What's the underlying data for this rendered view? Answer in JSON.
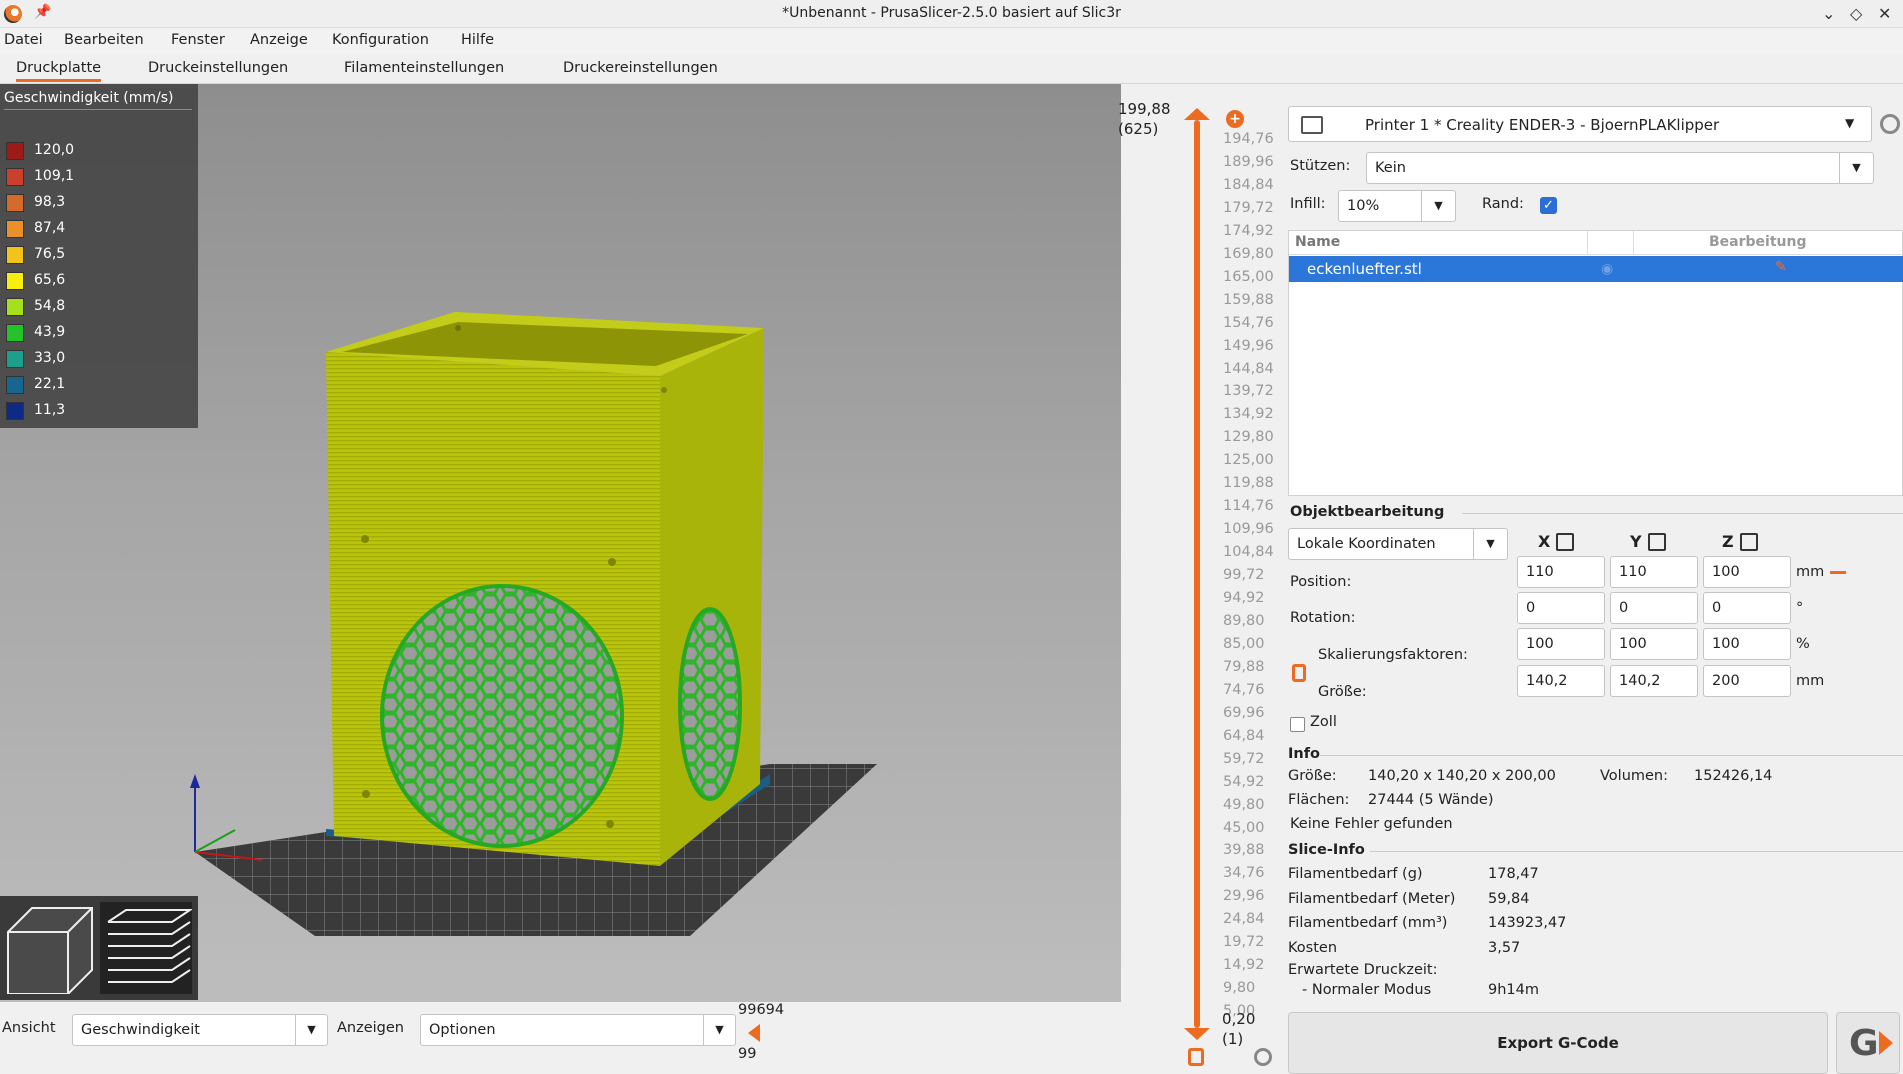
{
  "window": {
    "title": "*Unbenannt - PrusaSlicer-2.5.0 basiert auf Slic3r"
  },
  "menu": [
    "Datei",
    "Bearbeiten",
    "Fenster",
    "Anzeige",
    "Konfiguration",
    "Hilfe"
  ],
  "tabs": [
    "Druckplatte",
    "Druckeinstellungen",
    "Filamenteinstellungen",
    "Druckereinstellungen"
  ],
  "legend": {
    "title": "Geschwindigkeit (mm/s)",
    "items": [
      {
        "value": "120,0",
        "color": "#9c1a1a"
      },
      {
        "value": "109,1",
        "color": "#c9402c"
      },
      {
        "value": "98,3",
        "color": "#d46a2c"
      },
      {
        "value": "87,4",
        "color": "#e8902a"
      },
      {
        "value": "76,5",
        "color": "#f2c21d"
      },
      {
        "value": "65,6",
        "color": "#f7ee0d"
      },
      {
        "value": "54,8",
        "color": "#a5e01b"
      },
      {
        "value": "43,9",
        "color": "#26c22b"
      },
      {
        "value": "33,0",
        "color": "#1e9e8c"
      },
      {
        "value": "22,1",
        "color": "#16668f"
      },
      {
        "value": "11,3",
        "color": "#0c2a86"
      }
    ]
  },
  "bottom": {
    "ansicht_label": "Ansicht",
    "ansicht_value": "Geschwindigkeit",
    "anzeigen_label": "Anzeigen",
    "anzeigen_value": "Optionen",
    "hslider_top": "99694",
    "hslider_bottom": "99"
  },
  "vslider": {
    "top_value": "199,88",
    "top_layer": "(625)",
    "bottom_value": "0,20",
    "bottom_layer": "(1)",
    "ticks": [
      "194,76",
      "189,96",
      "184,84",
      "179,72",
      "174,92",
      "169,80",
      "165,00",
      "159,88",
      "154,76",
      "149,96",
      "144,84",
      "139,72",
      "134,92",
      "129,80",
      "125,00",
      "119,88",
      "114,76",
      "109,96",
      "104,84",
      "99,72",
      "94,92",
      "89,80",
      "85,00",
      "79,88",
      "74,76",
      "69,96",
      "64,84",
      "59,72",
      "54,92",
      "49,80",
      "45,00",
      "39,88",
      "34,76",
      "29,96",
      "24,84",
      "19,72",
      "14,92",
      "9,80",
      "5,00"
    ]
  },
  "printer": {
    "name": "Printer 1 * Creality ENDER-3 - BjoernPLAKlipper"
  },
  "support": {
    "label": "Stützen:",
    "value": "Kein"
  },
  "infill": {
    "label": "Infill:",
    "value": "10%"
  },
  "brim": {
    "label": "Rand:",
    "checked": true
  },
  "objects": {
    "col_name": "Name",
    "col_edit": "Bearbeitung",
    "rows": [
      {
        "name": "eckenluefter.stl"
      }
    ]
  },
  "objedit": {
    "title": "Objektbearbeitung",
    "coords": "Lokale Koordinaten",
    "axes": [
      "X",
      "Y",
      "Z"
    ],
    "position_label": "Position:",
    "position": [
      "110",
      "110",
      "100"
    ],
    "position_unit": "mm",
    "rotation_label": "Rotation:",
    "rotation": [
      "0",
      "0",
      "0"
    ],
    "rotation_unit": "°",
    "scale_label": "Skalierungsfaktoren:",
    "scale": [
      "100",
      "100",
      "100"
    ],
    "scale_unit": "%",
    "size_label": "Größe:",
    "size": [
      "140,2",
      "140,2",
      "200"
    ],
    "size_unit": "mm",
    "inch_label": "Zoll"
  },
  "info": {
    "title": "Info",
    "size_label": "Größe:",
    "size_value": "140,20 x 140,20 x 200,00",
    "volume_label": "Volumen:",
    "volume_value": "152426,14",
    "facets_label": "Flächen:",
    "facets_value": "27444 (5 Wände)",
    "errors": "Keine Fehler gefunden"
  },
  "sliceinfo": {
    "title": "Slice-Info",
    "rows": [
      {
        "label": "Filamentbedarf (g)",
        "value": "178,47"
      },
      {
        "label": "Filamentbedarf (Meter)",
        "value": "59,84"
      },
      {
        "label": "Filamentbedarf (mm³)",
        "value": "143923,47"
      },
      {
        "label": "Kosten",
        "value": "3,57"
      }
    ],
    "time_label": "Erwartete Druckzeit:",
    "mode_label": "- Normaler Modus",
    "mode_value": "9h14m"
  },
  "export": {
    "label": "Export G-Code"
  }
}
